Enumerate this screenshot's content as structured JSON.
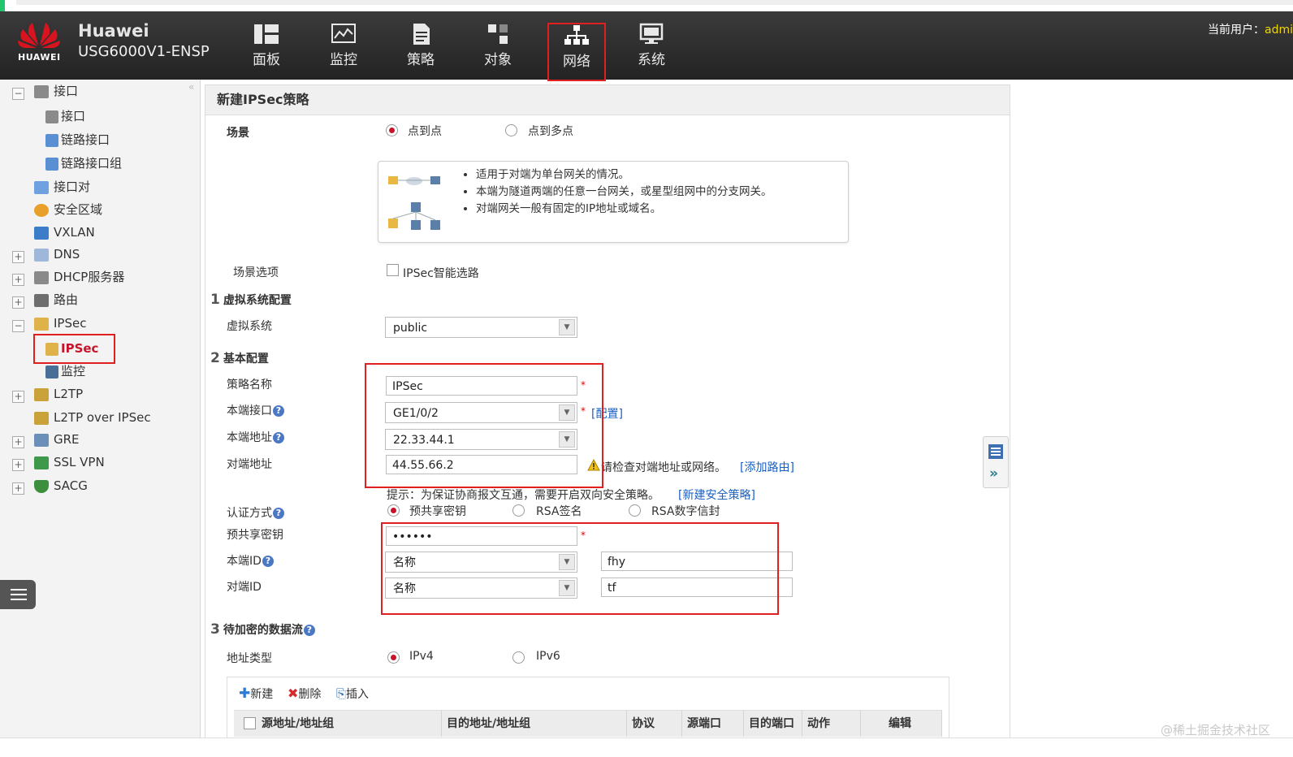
{
  "header": {
    "logo_text": "HUAWEI",
    "brand": "Huawei",
    "model": "USG6000V1-ENSP",
    "nav": [
      {
        "label": "面板",
        "icon": "dashboard-icon"
      },
      {
        "label": "监控",
        "icon": "monitor-icon"
      },
      {
        "label": "策略",
        "icon": "policy-icon"
      },
      {
        "label": "对象",
        "icon": "object-icon"
      },
      {
        "label": "网络",
        "icon": "network-icon",
        "active": true
      },
      {
        "label": "系统",
        "icon": "system-icon"
      }
    ],
    "user_label": "当前用户：",
    "user_name": "admi"
  },
  "sidebar": {
    "items": [
      {
        "label": "接口",
        "toggle": "−"
      },
      {
        "label": "接口"
      },
      {
        "label": "链路接口"
      },
      {
        "label": "链路接口组"
      },
      {
        "label": "接口对"
      },
      {
        "label": "安全区域"
      },
      {
        "label": "VXLAN"
      },
      {
        "label": "DNS",
        "toggle": "+"
      },
      {
        "label": "DHCP服务器",
        "toggle": "+"
      },
      {
        "label": "路由",
        "toggle": "+"
      },
      {
        "label": "IPSec",
        "toggle": "−"
      },
      {
        "label": "IPSec",
        "selected": true
      },
      {
        "label": "监控"
      },
      {
        "label": "L2TP",
        "toggle": "+"
      },
      {
        "label": "L2TP over IPSec"
      },
      {
        "label": "GRE",
        "toggle": "+"
      },
      {
        "label": "SSL VPN",
        "toggle": "+"
      },
      {
        "label": "SACG",
        "toggle": "+"
      }
    ],
    "collapse_glyph": "«"
  },
  "form": {
    "title": "新建IPSec策略",
    "scenario_label": "场景",
    "scenario_options": [
      "点到点",
      "点到多点"
    ],
    "tips": [
      "适用于对端为单台网关的情况。",
      "本端为隧道两端的任意一台网关，或星型组网中的分支网关。",
      "对端网关一般有固定的IP地址或域名。"
    ],
    "scenario_opt_label": "场景选项",
    "smart_route_label": "IPSec智能选路",
    "sec1_num": "1",
    "sec1_title": "虚拟系统配置",
    "vsys_label": "虚拟系统",
    "vsys_value": "public",
    "sec2_num": "2",
    "sec2_title": "基本配置",
    "policy_name_label": "策略名称",
    "policy_name_value": "IPSec",
    "local_if_label": "本端接口",
    "local_if_value": "GE1/0/2",
    "config_link": "[配置]",
    "local_addr_label": "本端地址",
    "local_addr_value": "22.33.44.1",
    "peer_addr_label": "对端地址",
    "peer_addr_value": "44.55.66.2",
    "peer_warning": "请检查对端地址或网络。",
    "add_route_link": "[添加路由]",
    "hint_text": "提示：为保证协商报文互通，需要开启双向安全策略。",
    "new_policy_link": "[新建安全策略]",
    "auth_label": "认证方式",
    "auth_options": [
      "预共享密钥",
      "RSA签名",
      "RSA数字信封"
    ],
    "psk_label": "预共享密钥",
    "psk_value": "••••••",
    "local_id_label": "本端ID",
    "local_id_type": "名称",
    "local_id_value": "fhy",
    "peer_id_label": "对端ID",
    "peer_id_type": "名称",
    "peer_id_value": "tf",
    "required_mark": "*",
    "help_mark": "?",
    "sec3_num": "3",
    "sec3_title": "待加密的数据流",
    "addr_type_label": "地址类型",
    "addr_type_options": [
      "IPv4",
      "IPv6"
    ],
    "toolbar": [
      "新建",
      "删除",
      "插入"
    ],
    "columns": [
      "源地址/地址组",
      "目的地址/地址组",
      "协议",
      "源端口",
      "目的端口",
      "动作",
      "编辑"
    ]
  },
  "watermark": "@稀土掘金技术社区",
  "colors": {
    "accent_red": "#e02020",
    "brand_red": "#c8142b",
    "link_blue": "#1b5fc1",
    "header_bg": "#2d2d2d"
  }
}
